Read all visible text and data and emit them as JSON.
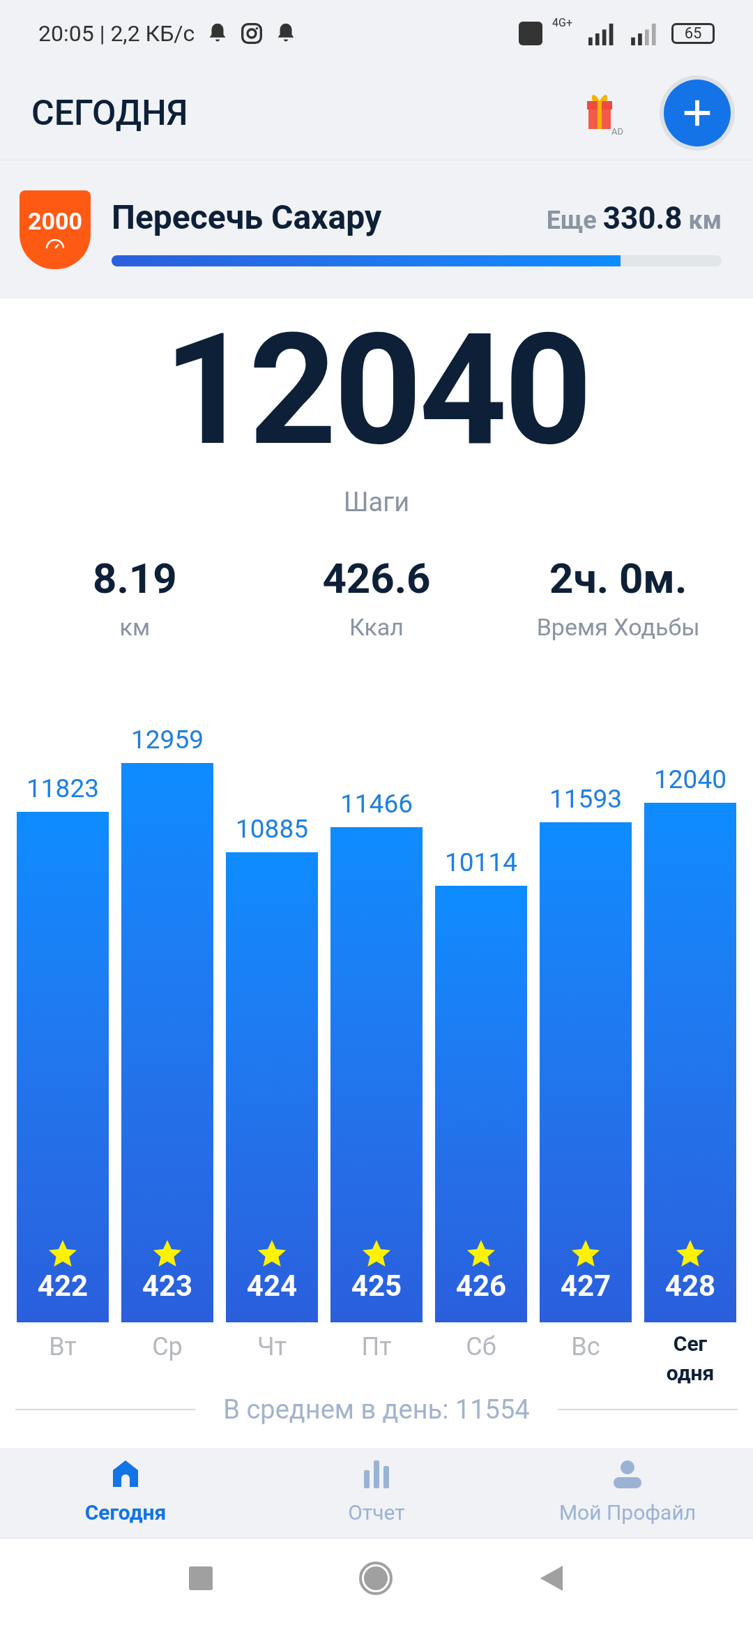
{
  "status_bar": {
    "time": "20:05 | 2,2 КБ/с",
    "battery": "65",
    "network": "4G+"
  },
  "header": {
    "title": "СЕГОДНЯ",
    "gift_badge": "AD"
  },
  "challenge": {
    "badge": "2000",
    "title": "Пересечь Сахару",
    "remaining_label": "Еще",
    "remaining_value": "330.8",
    "remaining_unit": "км",
    "level": 0.834
  },
  "steps": {
    "value": "12040",
    "label": "Шаги"
  },
  "stats": [
    {
      "value": "8.19",
      "label": "км"
    },
    {
      "value": "426.6",
      "label": "Ккал"
    },
    {
      "value": "2ч. 0м.",
      "label": "Время Ходьбы"
    }
  ],
  "chart": {
    "chart_data": {
      "type": "bar",
      "categories": [
        "Вт",
        "Ср",
        "Чт",
        "Пт",
        "Сб",
        "Вс",
        "Сег одня"
      ],
      "values": [
        11823,
        12959,
        10885,
        11466,
        10114,
        11593,
        12040
      ],
      "data_labels": true
    },
    "day_badges": [
      {
        "count": "422",
        "goal_reached": true,
        "selected": false
      },
      {
        "count": "423",
        "goal_reached": true,
        "selected": false
      },
      {
        "count": "424",
        "goal_reached": true,
        "selected": false
      },
      {
        "count": "425",
        "goal_reached": true,
        "selected": false
      },
      {
        "count": "426",
        "goal_reached": true,
        "selected": false
      },
      {
        "count": "427",
        "goal_reached": true,
        "selected": false
      },
      {
        "count": "428",
        "goal_reached": true,
        "selected": true
      }
    ],
    "average": "В среднем в день: 11554"
  },
  "nav": [
    {
      "label": "Сегодня",
      "kind": "home",
      "selected": true
    },
    {
      "label": "Отчет",
      "kind": "report",
      "selected": false
    },
    {
      "label": "Мой Профайл",
      "kind": "profile",
      "selected": false
    }
  ]
}
